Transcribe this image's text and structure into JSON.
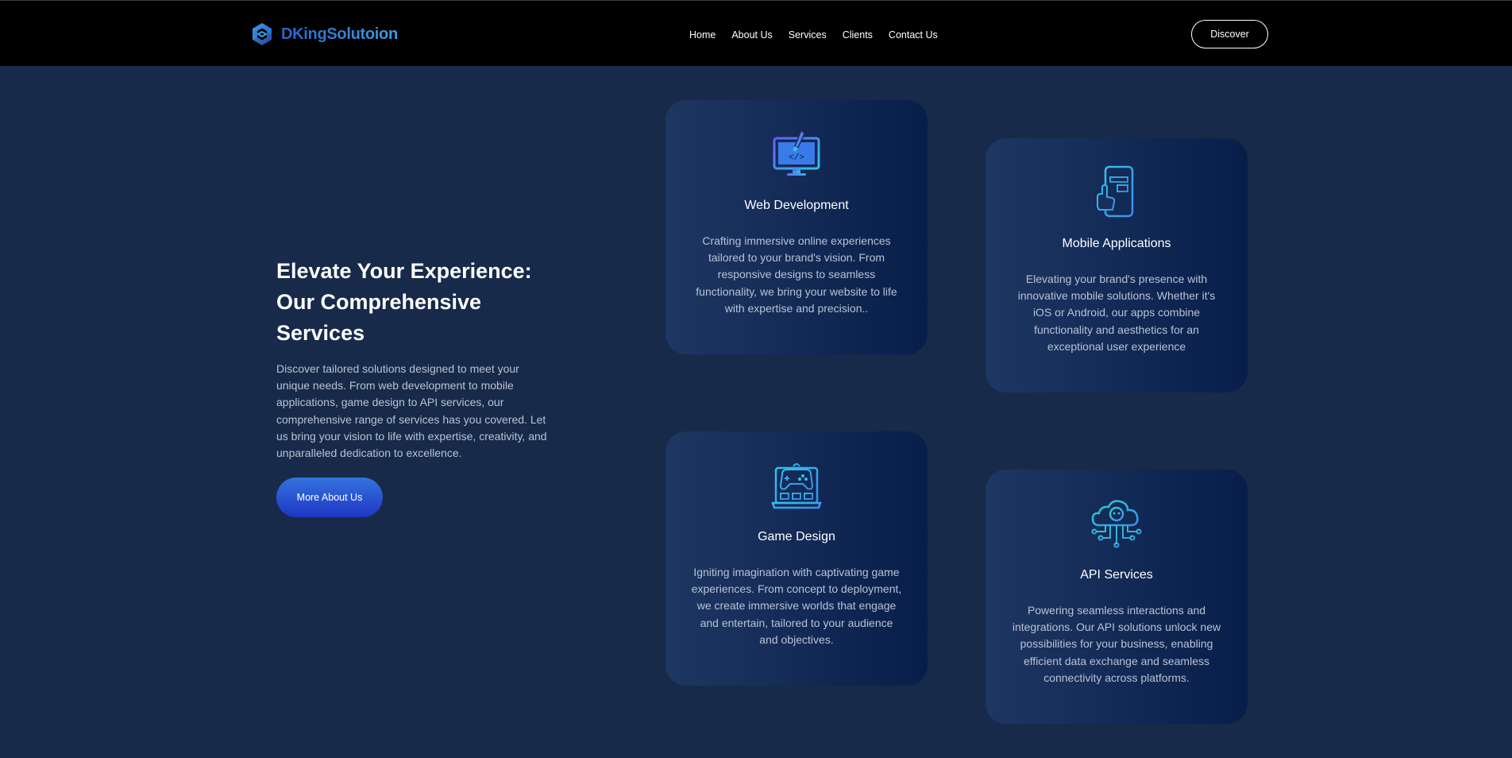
{
  "brand": {
    "name": "DKingSolutoion",
    "logo_icon": "hexagon-link-logo-icon"
  },
  "nav": {
    "links": [
      {
        "label": "Home"
      },
      {
        "label": "About Us"
      },
      {
        "label": "Services"
      },
      {
        "label": "Clients"
      },
      {
        "label": "Contact Us"
      }
    ],
    "cta_label": "Discover"
  },
  "intro": {
    "title_line1": "Elevate Your Experience:",
    "title_line2": "Our Comprehensive",
    "title_line3": "Services",
    "description": "Discover tailored solutions designed to meet your unique needs. From web development to mobile applications, game design to API services, our comprehensive range of services has you covered. Let us bring your vision to life with expertise, creativity, and unparalleled dedication to excellence.",
    "button_label": "More About Us"
  },
  "services": [
    {
      "title": "Web Development",
      "icon": "monitor-brush-icon",
      "description": "Crafting immersive online experiences tailored to your brand's vision. From responsive designs to seamless functionality, we bring your website to life with expertise and precision.."
    },
    {
      "title": "Mobile Applications",
      "icon": "phone-touch-icon",
      "description": "Elevating your brand's presence with innovative mobile solutions. Whether it's iOS or Android, our apps combine functionality and aesthetics for an exceptional user experience"
    },
    {
      "title": "Game Design",
      "icon": "gamepad-laptop-icon",
      "description": "Igniting imagination with captivating game experiences. From concept to deployment, we create immersive worlds that engage and entertain, tailored to your audience and objectives."
    },
    {
      "title": "API Services",
      "icon": "cloud-gear-network-icon",
      "description": "Powering seamless interactions and integrations. Our API solutions unlock new possibilities for your business, enabling efficient data exchange and seamless connectivity across platforms."
    }
  ],
  "colors": {
    "background": "#172a4a",
    "navbar": "#000000",
    "accent": "#2a62c9",
    "icon_cyan": "#2fc3ea"
  }
}
